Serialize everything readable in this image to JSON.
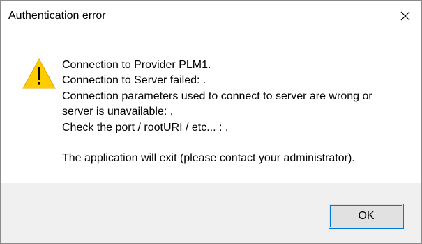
{
  "window": {
    "title": "Authentication error"
  },
  "titlebar": {
    "close_icon": "close-icon"
  },
  "message": {
    "icon": "warning-icon",
    "lines": [
      "Connection to Provider PLM1.",
      "Connection to Server failed: .",
      "Connection parameters used to connect to server are wrong or",
      "server is unavailable: .",
      "Check the port / rootURI / etc... : ."
    ],
    "exit_notice": "The application will exit (please contact your administrator)."
  },
  "footer": {
    "ok_label": "OK"
  },
  "colors": {
    "warning_fill": "#ffcc00",
    "focus_border": "#0078d7",
    "footer_bg": "#f0f0f0",
    "button_bg": "#e1e1e1"
  }
}
